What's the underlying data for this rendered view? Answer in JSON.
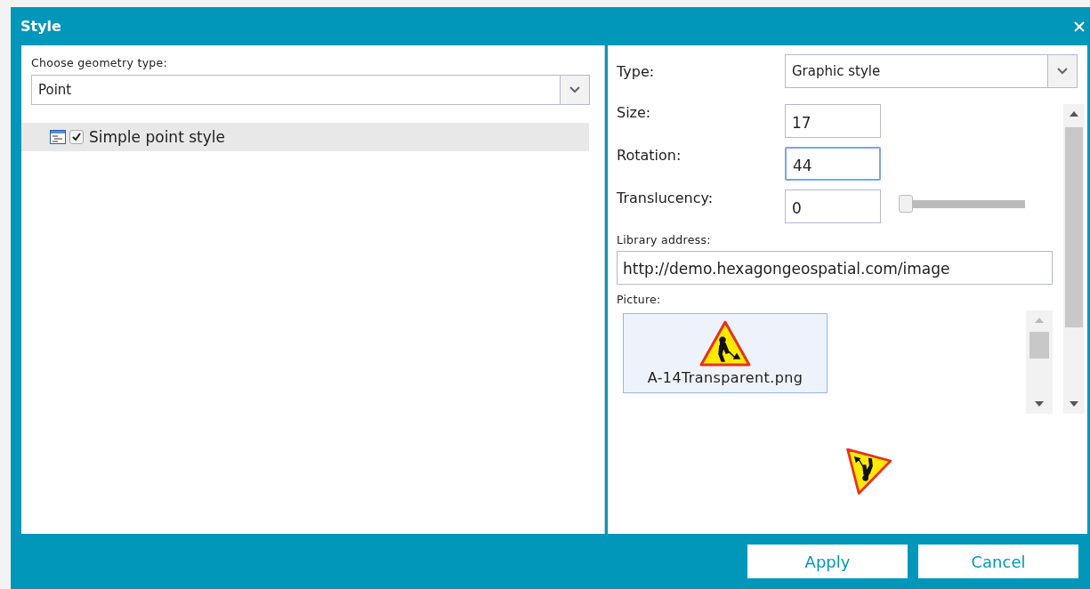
{
  "window": {
    "title": "Style"
  },
  "left": {
    "label": "Choose geometry type:",
    "geometry": "Point",
    "tree": [
      {
        "label": "Simple point style",
        "checked": true,
        "selected": true
      }
    ]
  },
  "right": {
    "type_label": "Type:",
    "type_value": "Graphic style",
    "fields": [
      {
        "kind": "text",
        "label": "Size:",
        "value": "17",
        "focused": false
      },
      {
        "kind": "text",
        "label": "Rotation:",
        "value": "44",
        "focused": true
      },
      {
        "kind": "slider",
        "label": "Translucency:",
        "value": "0",
        "focused": false,
        "level": 0
      }
    ],
    "library_label": "Library address:",
    "library_value": "http://demo.hexagongeospatial.com/image",
    "picture_label": "Picture:",
    "pictures": [
      {
        "name": "A-14Transparent.png",
        "selected": true
      }
    ]
  },
  "buttons": [
    "Apply",
    "Cancel"
  ]
}
